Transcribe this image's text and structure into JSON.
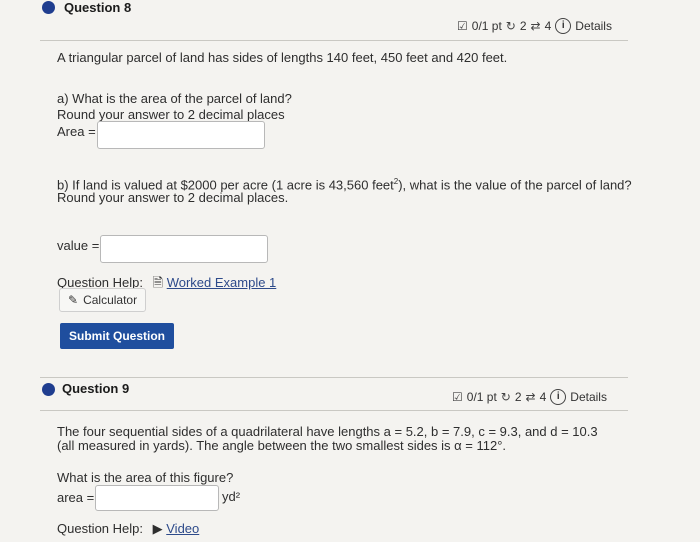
{
  "q8": {
    "title": "Question 8",
    "score": "0/1 pt",
    "retries": "2",
    "attempts": "4",
    "details": "Details",
    "prompt": "A triangular parcel of land has sides of lengths 140 feet, 450 feet and 420 feet.",
    "part_a_line1": "a) What is the area of the parcel of land?",
    "part_a_line2": "Round your answer to 2 decimal places",
    "area_label": "Area =",
    "area_value": "",
    "part_b_line1_pre": "b) If land is valued at $2000 per acre (1 acre is 43,560 feet",
    "part_b_sup": "2",
    "part_b_line1_post": "), what is the value of the parcel of land?",
    "part_b_line2": "Round your answer to 2 decimal places.",
    "value_label": "value =",
    "value_value": "",
    "help_label": "Question Help:",
    "worked_example": "Worked Example 1",
    "calculator": "Calculator",
    "submit": "Submit Question"
  },
  "q9": {
    "title": "Question 9",
    "score": "0/1 pt",
    "retries": "2",
    "attempts": "4",
    "details": "Details",
    "prompt_line1": "The four sequential sides of a quadrilateral have lengths a = 5.2, b = 7.9, c = 9.3, and d = 10.3",
    "prompt_line2": "(all measured in yards). The angle between the two smallest sides is α = 112°.",
    "question": "What is the area of this figure?",
    "area_label": "area =",
    "area_value": "",
    "unit": "yd²",
    "help_label": "Question Help:",
    "video": "Video"
  },
  "colors": {
    "accent": "#1f3d8f",
    "button": "#1f4e9e",
    "background": "#f4f3f0"
  }
}
